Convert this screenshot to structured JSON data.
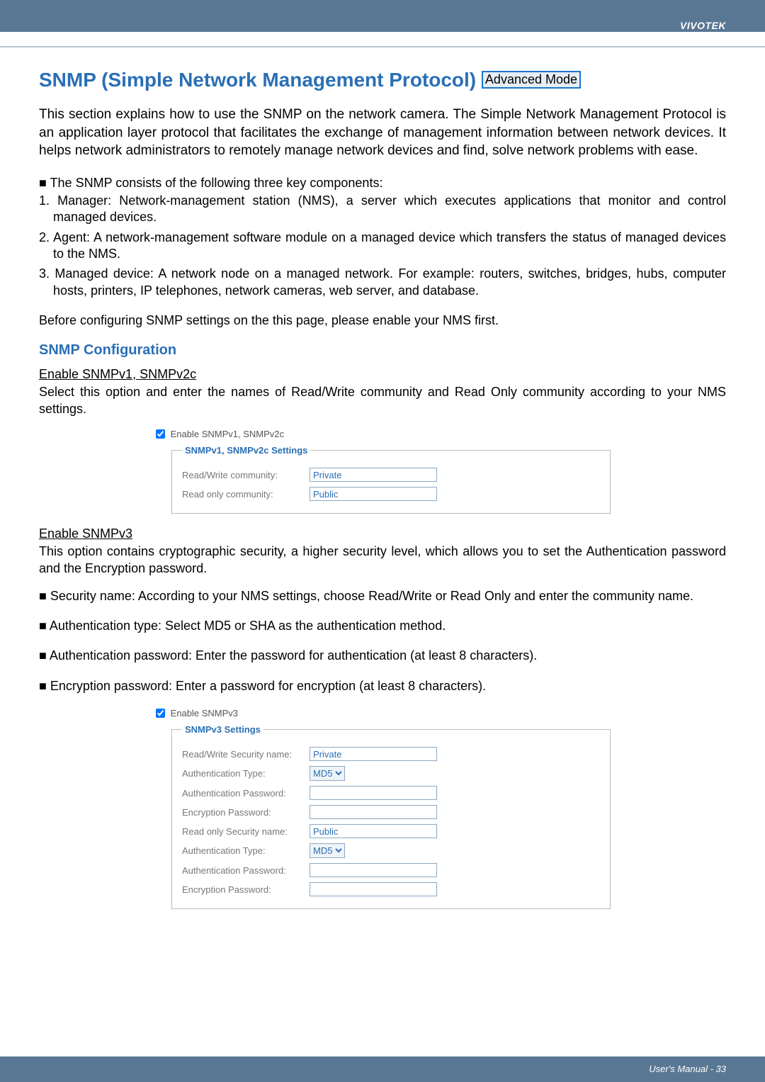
{
  "brand": "VIVOTEK",
  "title_main": "SNMP (Simple Network Management Protocol) ",
  "advanced_badge": "Advanced Mode",
  "intro": "This section explains how to use the SNMP on the network camera. The Simple Network Management Protocol is an application layer protocol that facilitates the exchange of management information between network devices. It helps network administrators to remotely manage network devices and find, solve network problems with ease.",
  "components_lead": "■ The SNMP consists of the following three key components:",
  "comp1": "1. Manager: Network-management station (NMS), a server which executes applications that monitor and control managed devices.",
  "comp2": "2. Agent: A network-management software module on a managed device which transfers the status of managed devices to the NMS.",
  "comp3": "3. Managed device: A network node on a managed network. For example: routers, switches, bridges, hubs, computer hosts, printers, IP telephones, network cameras, web server, and database.",
  "before_text": "Before configuring SNMP settings on the this page, please enable your NMS first.",
  "config_h": "SNMP Configuration",
  "v1v2_h": "Enable SNMPv1, SNMPv2c",
  "v1v2_p": "Select this option and enter the names of Read/Write community and Read Only community according to your NMS settings.",
  "v1v2_cb": "Enable SNMPv1, SNMPv2c",
  "v1v2_legend": "SNMPv1, SNMPv2c Settings",
  "rw_comm_label": "Read/Write community:",
  "rw_comm_val": "Private",
  "ro_comm_label": "Read only community:",
  "ro_comm_val": "Public",
  "v3_h": "Enable SNMPv3",
  "v3_p": "This option contains cryptographic security, a higher security level, which allows you to set the Authentication password and the Encryption password.",
  "b_sec": "■ Security name: According to your NMS settings, choose Read/Write or Read Only and enter the community name.",
  "b_authtype": "■ Authentication type: Select MD5 or SHA as the authentication method.",
  "b_authpwd": "■ Authentication password: Enter the password for authentication (at least 8 characters).",
  "b_encpwd": "■ Encryption password: Enter a password for encryption (at least 8 characters).",
  "v3_cb": "Enable SNMPv3",
  "v3_legend": "SNMPv3 Settings",
  "rw_sec_label": "Read/Write Security name:",
  "rw_sec_val": "Private",
  "auth_type_label": "Authentication Type:",
  "auth_type_val": "MD5",
  "auth_pwd_label": "Authentication Password:",
  "enc_pwd_label": "Encryption Password:",
  "ro_sec_label": "Read only Security name:",
  "ro_sec_val": "Public",
  "footer": "User's Manual - 33"
}
